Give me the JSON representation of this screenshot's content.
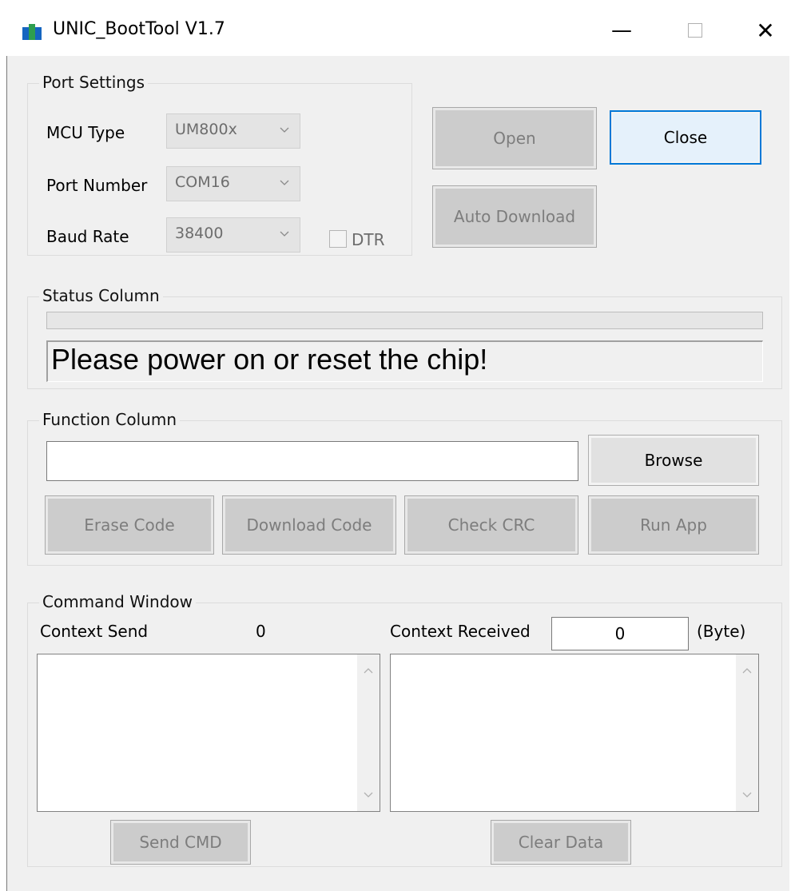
{
  "window": {
    "title": "UNIC_BootTool V1.7",
    "controls": {
      "minimize": "—",
      "close": "✕"
    }
  },
  "port_settings": {
    "group_label": "Port Settings",
    "mcu_type": {
      "label": "MCU Type",
      "value": "UM800x"
    },
    "port_number": {
      "label": "Port Number",
      "value": "COM16"
    },
    "baud_rate": {
      "label": "Baud Rate",
      "value": "38400"
    },
    "dtr": {
      "label": "DTR",
      "checked": false
    }
  },
  "connection_buttons": {
    "open": "Open",
    "close": "Close",
    "auto_download": "Auto Download"
  },
  "status": {
    "group_label": "Status Column",
    "progress_fraction": 0.0,
    "message": "Please power on or reset the chip!"
  },
  "function": {
    "group_label": "Function Column",
    "file_path": "",
    "browse": "Browse",
    "erase_code": "Erase Code",
    "download_code": "Download Code",
    "check_crc": "Check CRC",
    "run_app": "Run App"
  },
  "command": {
    "group_label": "Command Window",
    "send_label": "Context Send",
    "send_count": "0",
    "received_label": "Context Received",
    "received_count": "0",
    "byte_unit": "(Byte)",
    "send_cmd": "Send CMD",
    "clear_data": "Clear Data"
  },
  "icons": {
    "app": "unic-app-icon",
    "dropdown": "chevron-down-icon",
    "scroll_up": "chevron-up-icon",
    "scroll_down": "chevron-down-icon"
  },
  "colors": {
    "default_button_border": "#0078d7",
    "window_background": "#f0f0f0",
    "app_icon_blue": "#1565c0",
    "app_icon_green": "#2e9e4f"
  }
}
